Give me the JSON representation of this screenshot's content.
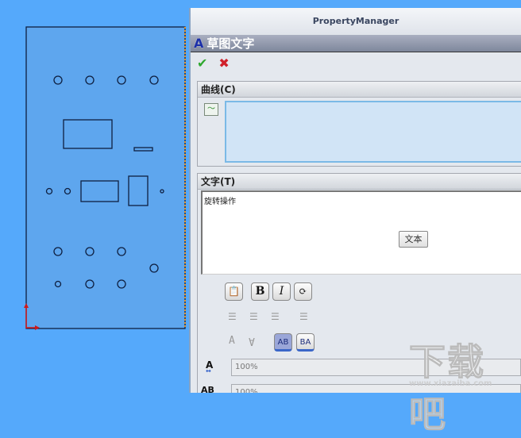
{
  "window": {
    "title": "PropertyManager"
  },
  "feature": {
    "title": "草图文字",
    "ok_icon": "check-icon",
    "cancel_icon": "close-icon"
  },
  "curves": {
    "header": "曲线(C)"
  },
  "text": {
    "header": "文字(T)",
    "value": "旋转操作",
    "insert_button": "文本"
  },
  "format": {
    "bold": "B",
    "italic": "I",
    "direction_ltr": "AB",
    "direction_rtl": "BA"
  },
  "fields": {
    "width_factor": "100%",
    "spacing": "100%"
  },
  "watermark": {
    "text": "下载吧",
    "url": "www.xiazaiba.com"
  },
  "colors": {
    "canvas": "#55a9fb",
    "plate": "#5ea6ee",
    "accent": "#7bb9e6"
  }
}
